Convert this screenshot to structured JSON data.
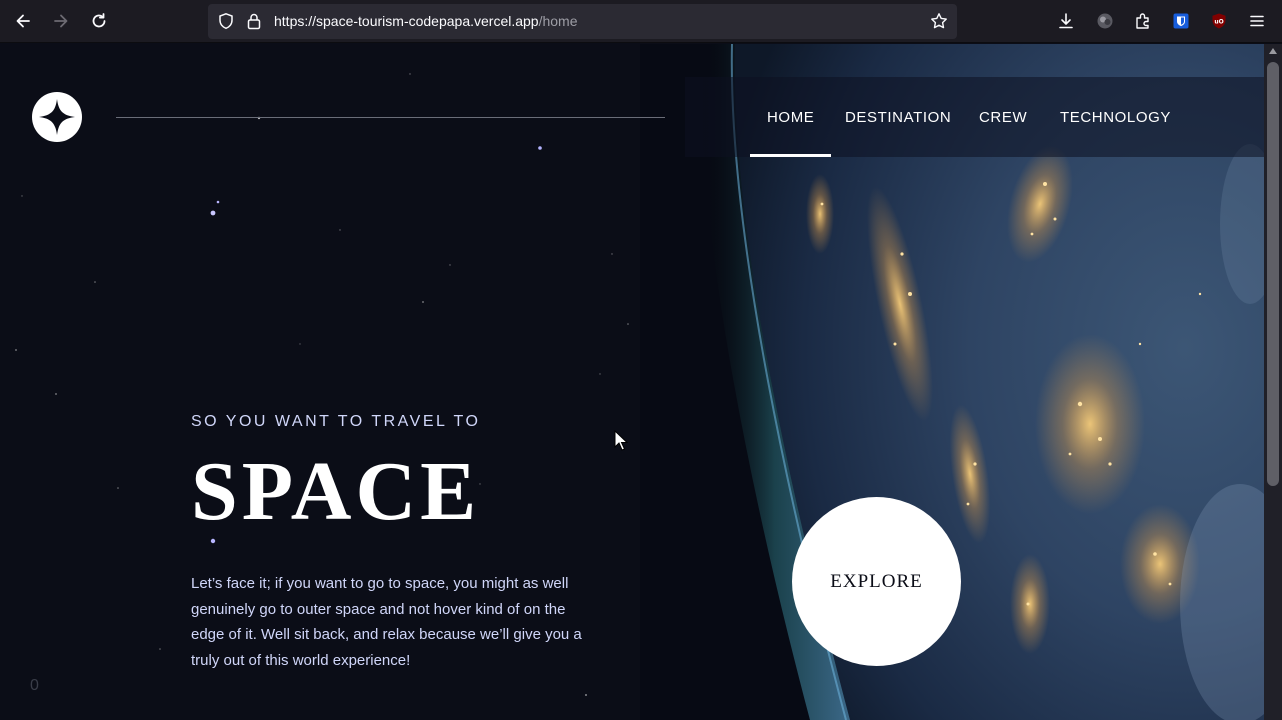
{
  "browser": {
    "url_base": "https://space-tourism-codepapa.vercel.app",
    "url_path": "/home",
    "icons": [
      "back-arrow-icon",
      "forward-arrow-icon",
      "reload-icon",
      "shield-icon",
      "lock-icon",
      "star-bookmark-icon",
      "download-icon",
      "account-icon",
      "extensions-icon",
      "bitwarden-icon",
      "ublock-icon",
      "menu-icon"
    ]
  },
  "nav": {
    "items": [
      {
        "label": "HOME",
        "active": true
      },
      {
        "label": "DESTINATION",
        "active": false
      },
      {
        "label": "CREW",
        "active": false
      },
      {
        "label": "TECHNOLOGY",
        "active": false
      }
    ]
  },
  "hero": {
    "eyebrow": "SO YOU WANT TO TRAVEL TO",
    "title": "SPACE",
    "body": "Let’s face it; if you want to go to space, you might as well genuinely go to outer space and not hover kind of on the edge of it. Well sit back, and relax because we’ll give you a truly out of this world experience!",
    "cta": "EXPLORE"
  },
  "footer": {
    "corner_text": "0"
  },
  "colors": {
    "background": "#0b0d17",
    "text_light": "#d0d6f9",
    "white": "#ffffff"
  }
}
